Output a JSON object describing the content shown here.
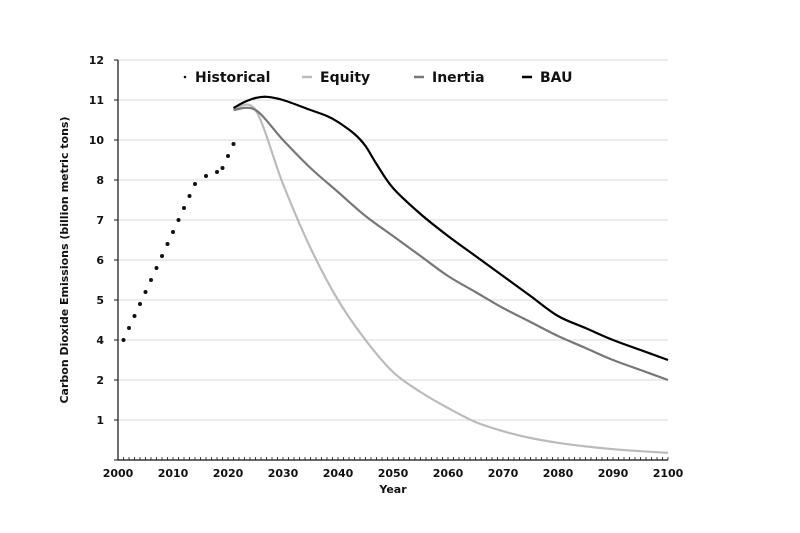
{
  "chart_data": {
    "type": "line",
    "title": "",
    "xlabel": "Year",
    "ylabel": "Carbon Dioxide Emissions (billion metric tons)",
    "xlim": [
      2000,
      2100
    ],
    "ylim": [
      0,
      12
    ],
    "grid": true,
    "legend_position": "top",
    "x_ticks": [
      2000,
      2010,
      2020,
      2030,
      2040,
      2050,
      2060,
      2070,
      2080,
      2090,
      2100
    ],
    "x_tick_labels": [
      "2000",
      "2010",
      "2020",
      "2030",
      "2040",
      "2050",
      "2060",
      "2070",
      "2080",
      "2090",
      "2100"
    ],
    "y_ticks": [
      1,
      2,
      3,
      4,
      5,
      6,
      7,
      8,
      9,
      10,
      11,
      12
    ],
    "y_tick_labels": [
      "1",
      "2",
      "4",
      "5",
      "6",
      "7",
      "8",
      "10",
      "11",
      "12"
    ],
    "y_tick_label_positions": [
      1,
      2,
      3,
      4,
      5,
      6,
      7,
      8,
      9,
      10
    ],
    "y_tick_labels_note": "Labels as printed on the axis at the evenly spaced gridlines (values plotted on gridline scale 0-12; printed labels skip 3 and 9)",
    "y_tick_labels_full": [
      {
        "at": 1,
        "label": "1"
      },
      {
        "at": 2,
        "label": "2"
      },
      {
        "at": 3,
        "label": "4"
      },
      {
        "at": 4,
        "label": "5"
      },
      {
        "at": 5,
        "label": "6"
      },
      {
        "at": 6,
        "label": "7"
      },
      {
        "at": 7,
        "label": "8"
      },
      {
        "at": 8,
        "label": "10"
      },
      {
        "at": 9,
        "label": "11"
      },
      {
        "at": 10,
        "label": "12"
      }
    ],
    "series": [
      {
        "name": "Historical",
        "style": "dots",
        "color": "#111111",
        "x": [
          2001,
          2002,
          2003,
          2004,
          2005,
          2006,
          2007,
          2008,
          2009,
          2010,
          2011,
          2012,
          2013,
          2014,
          2016,
          2018,
          2019,
          2020,
          2021
        ],
        "values": [
          3.0,
          3.3,
          3.6,
          3.9,
          4.2,
          4.5,
          4.8,
          5.1,
          5.4,
          5.7,
          6.0,
          6.3,
          6.6,
          6.9,
          7.1,
          7.2,
          7.3,
          7.6,
          7.9
        ]
      },
      {
        "name": "Equity",
        "style": "line",
        "color": "#bbbbbb",
        "x": [
          2021,
          2025,
          2030,
          2035,
          2040,
          2045,
          2050,
          2055,
          2060,
          2065,
          2070,
          2075,
          2080,
          2085,
          2090,
          2095,
          2100
        ],
        "values": [
          8.75,
          8.75,
          6.9,
          5.3,
          4.0,
          3.0,
          2.2,
          1.7,
          1.3,
          0.95,
          0.72,
          0.55,
          0.43,
          0.34,
          0.27,
          0.22,
          0.18
        ]
      },
      {
        "name": "Inertia",
        "style": "line",
        "color": "#777777",
        "x": [
          2021,
          2025,
          2030,
          2035,
          2040,
          2045,
          2050,
          2055,
          2060,
          2065,
          2070,
          2075,
          2080,
          2085,
          2090,
          2095,
          2100
        ],
        "values": [
          8.75,
          8.75,
          8.0,
          7.3,
          6.7,
          6.1,
          5.6,
          5.1,
          4.6,
          4.2,
          3.8,
          3.45,
          3.1,
          2.8,
          2.5,
          2.25,
          2.0
        ]
      },
      {
        "name": "BAU",
        "style": "line",
        "color": "#000000",
        "x": [
          2021,
          2023,
          2025,
          2027,
          2030,
          2035,
          2038,
          2040,
          2043,
          2045,
          2047,
          2050,
          2055,
          2060,
          2065,
          2070,
          2075,
          2080,
          2085,
          2090,
          2095,
          2100
        ],
        "values": [
          8.8,
          8.95,
          9.05,
          9.08,
          9.0,
          8.75,
          8.6,
          8.45,
          8.15,
          7.85,
          7.4,
          6.8,
          6.15,
          5.6,
          5.1,
          4.6,
          4.1,
          3.6,
          3.3,
          3.0,
          2.75,
          2.5
        ]
      }
    ]
  }
}
